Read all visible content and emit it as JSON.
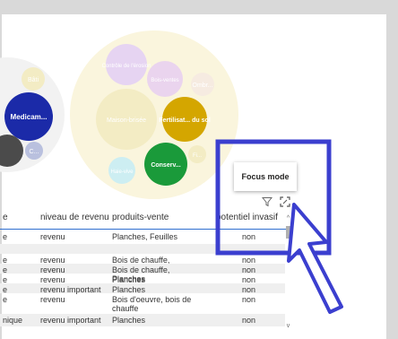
{
  "chart": {
    "bubbles": [
      {
        "label": "Medicam...",
        "fill": "#1b2aa8",
        "text": "#ffffff"
      },
      {
        "label": "Fertilisat... du sol",
        "fill": "#d4a600",
        "text": "#ffffff"
      },
      {
        "label": "Conserv...",
        "fill": "#1a9a3a",
        "text": "#ffffff"
      },
      {
        "label": "Contrôle de l'érosion",
        "fill": "#e6d4f2",
        "text": "#ffffff"
      },
      {
        "label": "Bois-ventes",
        "fill": "#ead4ee",
        "text": "#ffffff"
      },
      {
        "label": "Ombr...",
        "fill": "#f6ebe1",
        "text": "#ffffff"
      },
      {
        "label": "Maison-brisée",
        "fill": "#f3ecc4",
        "text": "#ffffff"
      },
      {
        "label": "Haie-vive",
        "fill": "#cdeef2",
        "text": "#ffffff"
      },
      {
        "label": "Fi...",
        "fill": "#f3ecc4",
        "text": "#ffffff"
      },
      {
        "label": "Bâti",
        "fill": "#f3ecc4",
        "text": "#ffffff"
      },
      {
        "label": "C...",
        "fill": "#b9c0de",
        "text": "#ffffff"
      }
    ]
  },
  "tooltip": {
    "label": "Focus mode"
  },
  "table": {
    "headers": [
      "e",
      "niveau de revenu",
      "produits-vente",
      "potentiel invasif"
    ],
    "rows": [
      {
        "c0": "e",
        "c1": "revenu",
        "c2": "Planches, Feuilles",
        "c3": "non",
        "shade": false
      },
      {
        "c0": "",
        "c1": "",
        "c2": "",
        "c3": "",
        "shade": true
      },
      {
        "c0": "e",
        "c1": "revenu",
        "c2": "Bois de chauffe, Planches",
        "c3": "non",
        "shade": false
      },
      {
        "c0": "e",
        "c1": "revenu",
        "c2": "Bois de chauffe, Planches",
        "c3": "non",
        "shade": true
      },
      {
        "c0": "e",
        "c1": "revenu",
        "c2": "Planches",
        "c3": "non",
        "shade": false
      },
      {
        "c0": "e",
        "c1": "revenu important",
        "c2": "Planches",
        "c3": "non",
        "shade": true
      },
      {
        "c0": "e",
        "c1": "revenu",
        "c2": "Bois d'oeuvre, bois de chauffe",
        "c3": "non",
        "shade": false
      },
      {
        "c0": "nique",
        "c1": "revenu important",
        "c2": "Planches",
        "c3": "non",
        "shade": true
      }
    ]
  },
  "scrollbar": {
    "up": "^",
    "down": "v"
  },
  "annotation": {
    "color": "#3b3fcf"
  }
}
